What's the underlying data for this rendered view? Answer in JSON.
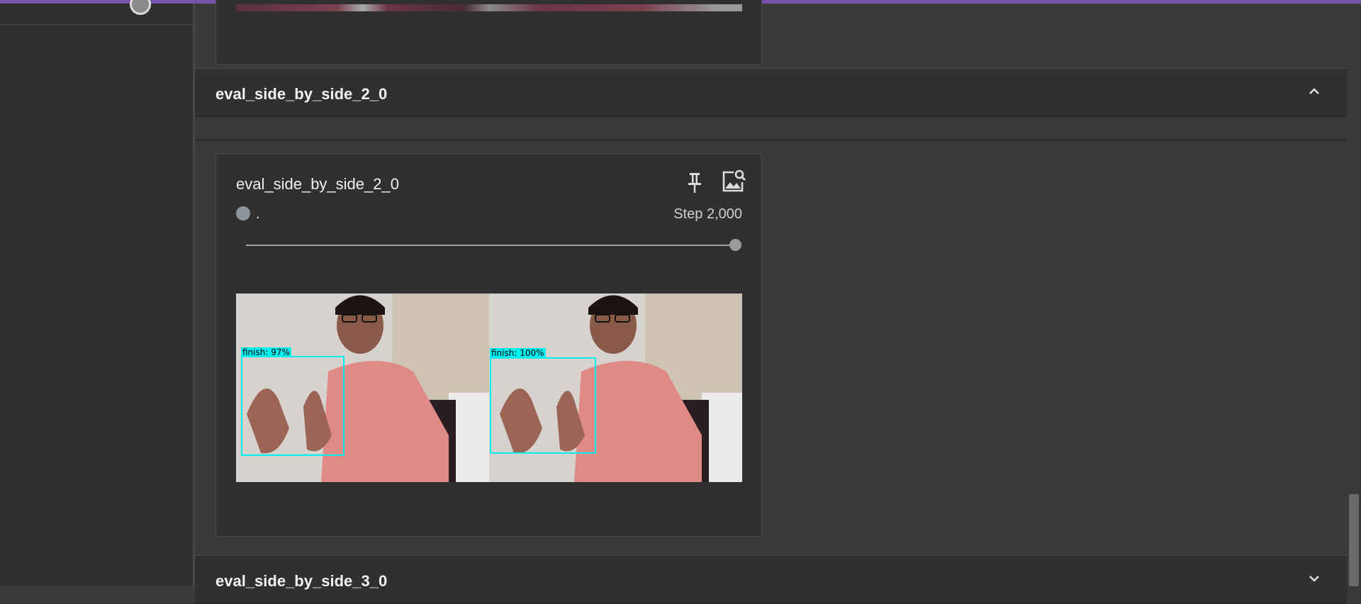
{
  "prev_card": {},
  "sections": [
    {
      "title": "eval_side_by_side_2_0",
      "state": "expanded",
      "chevron_icon": "chevron-up-icon"
    },
    {
      "title": "eval_side_by_side_3_0",
      "state": "collapsed",
      "chevron_icon": "chevron-down-icon"
    }
  ],
  "card": {
    "title": "eval_side_by_side_2_0",
    "run_label": ".",
    "step_label": "Step 2,000",
    "slider_value_fraction": 1.0,
    "pin_icon": "pin-icon",
    "zoom_icon": "image-search-icon",
    "images": [
      {
        "label": "finish: 97%"
      },
      {
        "label": "finish: 100%"
      }
    ]
  },
  "colors": {
    "top_accent": "#7b52ab",
    "bbox": "#00f0f0",
    "run_dot": "#8f959c"
  }
}
